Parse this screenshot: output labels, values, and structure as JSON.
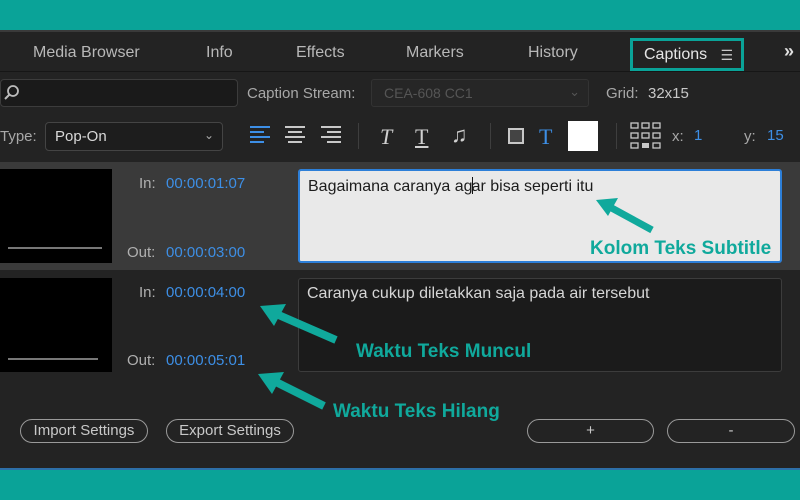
{
  "tabs": [
    "Media Browser",
    "Info",
    "Effects",
    "Markers",
    "History"
  ],
  "active_tab": "Captions",
  "toolbar": {
    "caption_stream_label": "Caption Stream:",
    "caption_stream_value": "CEA-608 CC1",
    "grid_label": "Grid:",
    "grid_value": "32x15",
    "type_label": "Type:",
    "type_value": "Pop-On",
    "x_label": "x:",
    "x_value": "1",
    "y_label": "y:",
    "y_value": "15"
  },
  "captions": [
    {
      "in_label": "In:",
      "in_time": "00:00:01:07",
      "out_label": "Out:",
      "out_time": "00:00:03:00",
      "text_before_caret": "Bagaimana caranya ag",
      "text_after_caret": "ar bisa seperti itu"
    },
    {
      "in_label": "In:",
      "in_time": "00:00:04:00",
      "out_label": "Out:",
      "out_time": "00:00:05:01",
      "text": "Caranya cukup diletakkan saja pada air tersebut"
    }
  ],
  "annotations": {
    "text_column": "Kolom Teks Subtitle",
    "appear_time": "Waktu Teks Muncul",
    "disappear_time": "Waktu Teks Hilang"
  },
  "buttons": {
    "import": "Import Settings",
    "export": "Export Settings",
    "add": "+",
    "remove": "-"
  },
  "colors": {
    "accent_teal": "#0aa398",
    "timecode_blue": "#3d8fe6",
    "panel_bg": "#232323"
  }
}
